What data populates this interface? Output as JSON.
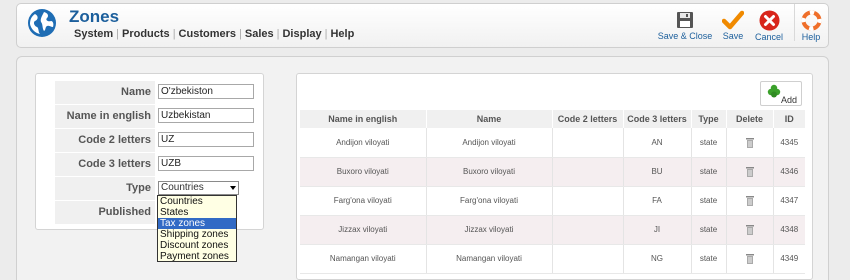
{
  "header": {
    "title": "Zones",
    "menu": [
      "System",
      "Products",
      "Customers",
      "Sales",
      "Display",
      "Help"
    ],
    "toolbar": {
      "save_close": "Save & Close",
      "save": "Save",
      "cancel": "Cancel",
      "help": "Help"
    }
  },
  "form": {
    "name_label": "Name",
    "name_value": "O'zbekiston",
    "name_en_label": "Name in english",
    "name_en_value": "Uzbekistan",
    "code2_label": "Code 2 letters",
    "code2_value": "UZ",
    "code3_label": "Code 3 letters",
    "code3_value": "UZB",
    "type_label": "Type",
    "type_value": "Countries",
    "published_label": "Published",
    "type_options": [
      "Countries",
      "States",
      "Tax zones",
      "Shipping zones",
      "Discount zones",
      "Payment zones"
    ],
    "type_highlighted": "Tax zones"
  },
  "table": {
    "add_label": "Add",
    "headers": [
      "Name in english",
      "Name",
      "Code 2 letters",
      "Code 3 letters",
      "Type",
      "Delete",
      "ID"
    ],
    "rows": [
      {
        "name_en": "Andijon viloyati",
        "name": "Andijon viloyati",
        "code2": "",
        "code3": "AN",
        "type": "state",
        "id": "4345"
      },
      {
        "name_en": "Buxoro viloyati",
        "name": "Buxoro viloyati",
        "code2": "",
        "code3": "BU",
        "type": "state",
        "id": "4346"
      },
      {
        "name_en": "Farg'ona viloyati",
        "name": "Farg'ona viloyati",
        "code2": "",
        "code3": "FA",
        "type": "state",
        "id": "4347"
      },
      {
        "name_en": "Jizzax viloyati",
        "name": "Jizzax viloyati",
        "code2": "",
        "code3": "JI",
        "type": "state",
        "id": "4348"
      },
      {
        "name_en": "Namangan viloyati",
        "name": "Namangan viloyati",
        "code2": "",
        "code3": "NG",
        "type": "state",
        "id": "4349"
      }
    ]
  },
  "colors": {
    "title_blue": "#1c5f9c",
    "check_orange": "#f08a00",
    "cancel_red": "#d8261c",
    "add_green": "#3aa02a",
    "alt_row": "#f5eef0",
    "dropdown_highlight": "#316ac5"
  },
  "icons": {
    "logo": "globe-icon",
    "save_close": "floppy-disk-icon",
    "save": "checkmark-icon",
    "cancel": "close-circle-icon",
    "help": "lifebuoy-icon",
    "add": "plus-icon",
    "delete": "trash-icon"
  }
}
